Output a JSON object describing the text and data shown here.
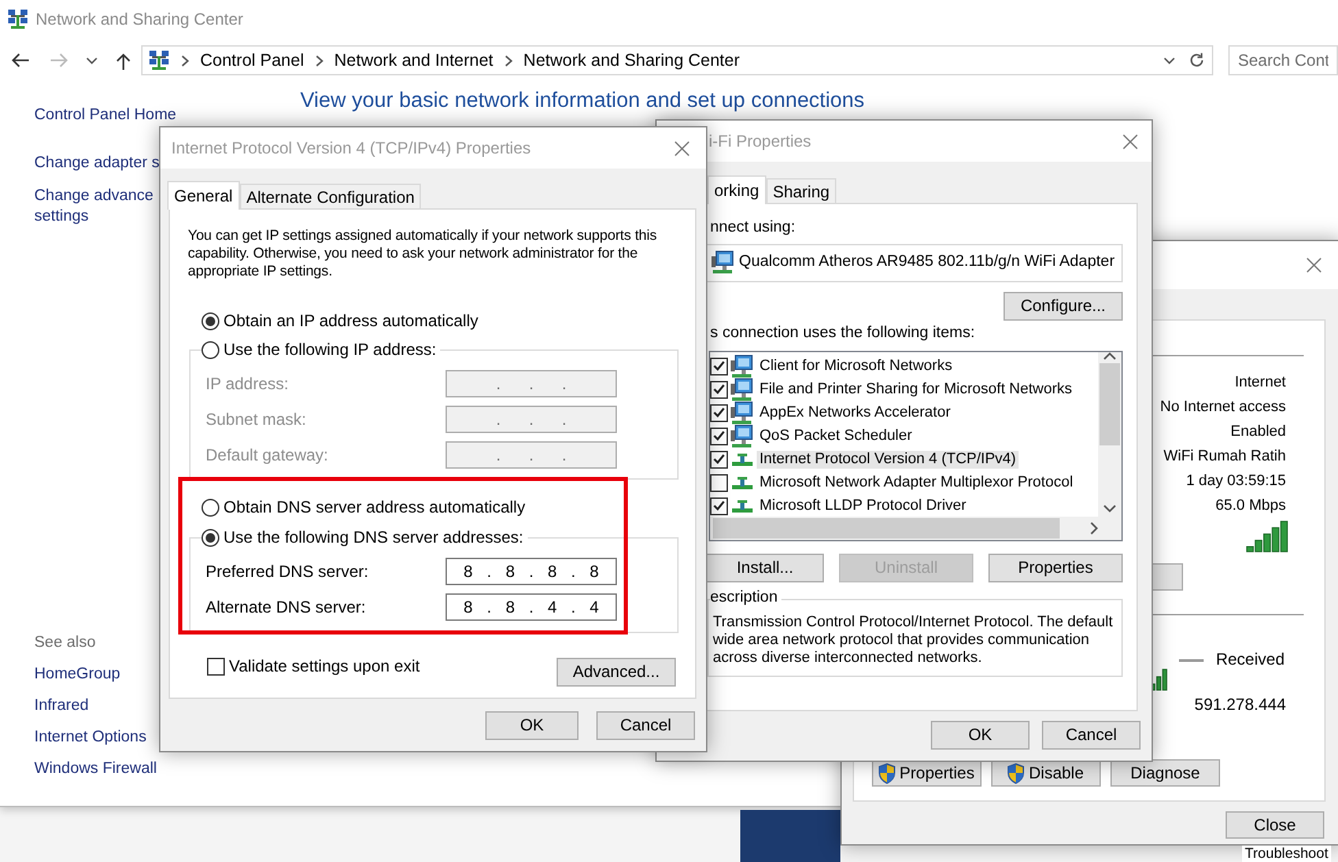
{
  "explorer": {
    "title": "Network and Sharing Center",
    "breadcrumb": [
      "Control Panel",
      "Network and Internet",
      "Network and Sharing Center"
    ],
    "search": {
      "placeholder": "Search Cont"
    },
    "sidebar": {
      "links": [
        {
          "lines": [
            "Control Panel Home"
          ]
        },
        {
          "lines": [
            "Change adapter s"
          ]
        },
        {
          "lines": [
            "Change advance",
            "settings"
          ]
        }
      ],
      "see_also": {
        "heading": "See also",
        "links": [
          "HomeGroup",
          "Infrared",
          "Internet Options",
          "Windows Firewall"
        ]
      }
    },
    "heading": "View your basic network information and set up connections"
  },
  "ipv4_dialog": {
    "title": "Internet Protocol Version 4 (TCP/IPv4) Properties",
    "tabs": [
      {
        "label": "General",
        "selected": true
      },
      {
        "label": "Alternate Configuration",
        "selected": false
      }
    ],
    "intro": "You can get IP settings assigned automatically if your network supports this capability. Otherwise, you need to ask your network administrator for the appropriate IP settings.",
    "separator": ".",
    "ip_options": [
      {
        "label": "Obtain an IP address automatically",
        "selected": true
      },
      {
        "label": "Use the following IP address:",
        "selected": false
      }
    ],
    "ip_fields": [
      {
        "label": "IP address:",
        "disabled": true
      },
      {
        "label": "Subnet mask:",
        "disabled": true
      },
      {
        "label": "Default gateway:",
        "disabled": true
      }
    ],
    "dns_options": [
      {
        "label": "Obtain DNS server address automatically",
        "selected": false
      },
      {
        "label": "Use the following DNS server addresses:",
        "selected": true
      }
    ],
    "dns_fields": [
      {
        "label": "Preferred DNS server:",
        "disabled": false,
        "octets": [
          "8",
          "8",
          "8",
          "8"
        ]
      },
      {
        "label": "Alternate DNS server:",
        "disabled": false,
        "octets": [
          "8",
          "8",
          "4",
          "4"
        ]
      }
    ],
    "validate": {
      "label": "Validate settings upon exit",
      "checked": false
    },
    "advanced": "Advanced...",
    "ok": "OK",
    "cancel": "Cancel"
  },
  "wifi_dialog": {
    "title": "i-Fi Properties",
    "tabs": [
      {
        "label": "orking",
        "selected": true
      },
      {
        "label": "Sharing",
        "selected": false
      }
    ],
    "connect_label": "nnect using:",
    "adapter": "Qualcomm Atheros AR9485 802.11b/g/n WiFi Adapter",
    "configure": "Configure...",
    "items_label": "s connection uses the following items:",
    "items": [
      {
        "label": "Client for Microsoft Networks",
        "kind": "service",
        "checked": true,
        "selected": false
      },
      {
        "label": "File and Printer Sharing for Microsoft Networks",
        "kind": "service",
        "checked": true,
        "selected": false
      },
      {
        "label": "AppEx Networks Accelerator",
        "kind": "service",
        "checked": true,
        "selected": false
      },
      {
        "label": "QoS Packet Scheduler",
        "kind": "service",
        "checked": true,
        "selected": false
      },
      {
        "label": "Internet Protocol Version 4 (TCP/IPv4)",
        "kind": "protocol",
        "checked": true,
        "selected": true
      },
      {
        "label": "Microsoft Network Adapter Multiplexor Protocol",
        "kind": "protocol",
        "checked": false,
        "selected": false
      },
      {
        "label": "Microsoft LLDP Protocol Driver",
        "kind": "protocol",
        "checked": true,
        "selected": false
      }
    ],
    "actions": [
      {
        "label": "Install...",
        "disabled": false
      },
      {
        "label": "Uninstall",
        "disabled": true
      },
      {
        "label": "Properties",
        "disabled": false
      }
    ],
    "description_label": "escription",
    "description": "Transmission Control Protocol/Internet Protocol. The default wide area network protocol that provides communication across diverse interconnected networks.",
    "ok": "OK",
    "cancel": "Cancel"
  },
  "status_dialog": {
    "values": [
      "Internet",
      "No Internet access",
      "Enabled",
      "WiFi Rumah Ratih",
      "1 day 03:59:15",
      "65.0 Mbps"
    ],
    "received_label": "Received",
    "received_value": "591.278.444",
    "buttons": [
      {
        "label": "Properties",
        "shield": true
      },
      {
        "label": "Disable",
        "shield": true
      },
      {
        "label": "Diagnose",
        "shield": false
      }
    ],
    "close": "Close"
  },
  "background_text": "Troubleshoot"
}
